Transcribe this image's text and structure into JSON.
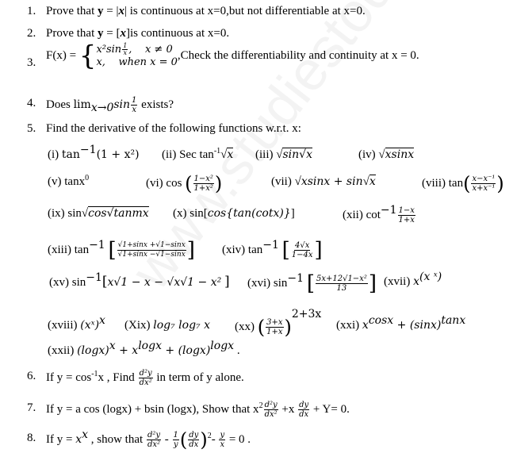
{
  "watermark": "www.studiestoday.com",
  "questions": [
    {
      "num": "1.",
      "text_a": "Prove that ",
      "bold_y": "y",
      "eq": " = |",
      "bold_x": "x",
      "text_b": "| is continuous at x=0,but not differentiable at x=0."
    },
    {
      "num": "2.",
      "text_a": "Prove that ",
      "bold_y": "y",
      "eq": " = [",
      "bold_x": "x",
      "text_b": "]is continuous at x=0."
    },
    {
      "num": "3.",
      "lhs": "F(x) = ",
      "case1_expr": "x²sin",
      "case1_frac_n": "1",
      "case1_frac_d": "x",
      "case1_cond": "x ≠ 0",
      "case2_expr": "x,",
      "case2_cond": "when x = 0",
      "text": ",Check the differentiability and continuity at x = 0."
    },
    {
      "num": "4.",
      "text_a": "Does ",
      "lim": "lim",
      "lim_sub": "x→0",
      "fn": "sin",
      "frac_n": "1",
      "frac_d": "x",
      "text_b": " exists?"
    },
    {
      "num": "5.",
      "text": "Find the derivative of the following functions w.r.t. x:"
    },
    {
      "num": "6.",
      "text_a": "If y = cos",
      "sup": "-1",
      "text_b": "x   , Find ",
      "frac_n": "d²y",
      "frac_d": "dx²",
      "text_c": " in term of y alone."
    },
    {
      "num": "7.",
      "text_a": "If y = a cos (logx) + bsin (logx), Show that  x",
      "sup": "2",
      "frac1_n": "d²y",
      "frac1_d": "dx²",
      "mid": " +x ",
      "frac2_n": "dy",
      "frac2_d": "dx",
      "text_b": " + Y= 0."
    },
    {
      "num": "8.",
      "text_a": "If y = ",
      "xx": "x",
      "xx_sup": "x",
      "text_b": " , show that ",
      "f1_n": "d²y",
      "f1_d": "dx²",
      "minus1": " - ",
      "f2_n": "1",
      "f2_d": "y",
      "f3_n": "dy",
      "f3_d": "dx",
      "sq": "2",
      "minus2": "- ",
      "f4_n": "y",
      "f4_d": "x",
      "text_c": " = 0 ."
    }
  ],
  "parts": {
    "i": {
      "label": "(i) ",
      "fn": "tan",
      "sup": "−1",
      "arg": "(1 + x²)"
    },
    "ii": {
      "label": "(ii) Sec tan",
      "sup": "-1",
      "arg": "x"
    },
    "iii": {
      "label": "(iii) ",
      "arg": "sin√x"
    },
    "iv": {
      "label": "(iv) ",
      "arg": "xsinx"
    },
    "v": {
      "label": "(v) tanx",
      "sup": "0"
    },
    "vi": {
      "label": "(vi) cos ",
      "n": "1−x²",
      "d": "1+x²"
    },
    "vii": {
      "label": "(vii) ",
      "expr": "xsinx + sin",
      "rad": "x"
    },
    "viii": {
      "label": "(viii)  tan",
      "n": "x−x⁻¹",
      "d": "x+x⁻¹"
    },
    "ix": {
      "label": "(ix) sin",
      "arg1": "cos",
      "arg2": "tanmx"
    },
    "x": {
      "label": "(x) sin[",
      "expr": "cos{tan(cotx)}",
      "close": "]"
    },
    "xii": {
      "label": "(xii) cot",
      "sup": "−1",
      "n": "1−x",
      "d": "1+x"
    },
    "xiii": {
      "label": "(xiii) tan",
      "sup": "−1",
      "n": "√1+sinx +√1−sinx",
      "d": "√1+sinx −√1−sinx"
    },
    "xiv": {
      "label": "(xiv) tan",
      "sup": "−1",
      "n": "4√x",
      "d": "1−4x"
    },
    "xv": {
      "label": "(xv) sin",
      "sup": "−1",
      "expr": "x√1 − x − √x√1 − x²"
    },
    "xvi": {
      "label": "(xvi) sin",
      "sup": "−1",
      "n": "5x+12√1−x²",
      "d": "13"
    },
    "xvii": {
      "label": "(xvii)  ",
      "base": "x",
      "sup": "(x ˣ)"
    },
    "xviii": {
      "label": "(xviii) ",
      "expr": "(xˣ)",
      "sup": "x"
    },
    "xix": {
      "label": "(Xix)  ",
      "expr": "log₇ log₇ x"
    },
    "xx": {
      "label": "(xx)  ",
      "n": "3+x",
      "d": "1+x",
      "sup": "2+3x"
    },
    "xxi": {
      "label": "(xxi) ",
      "a": "x",
      "a_sup": "cosx",
      "b": " + (sinx)",
      "b_sup": "tanx"
    },
    "xxii": {
      "label": "(xxii) ",
      "a": "(logx)",
      "a_sup": "x",
      "b": " + x",
      "b_sup": "logx",
      "c": " + (logx)",
      "c_sup": "logx",
      "end": " ."
    }
  }
}
